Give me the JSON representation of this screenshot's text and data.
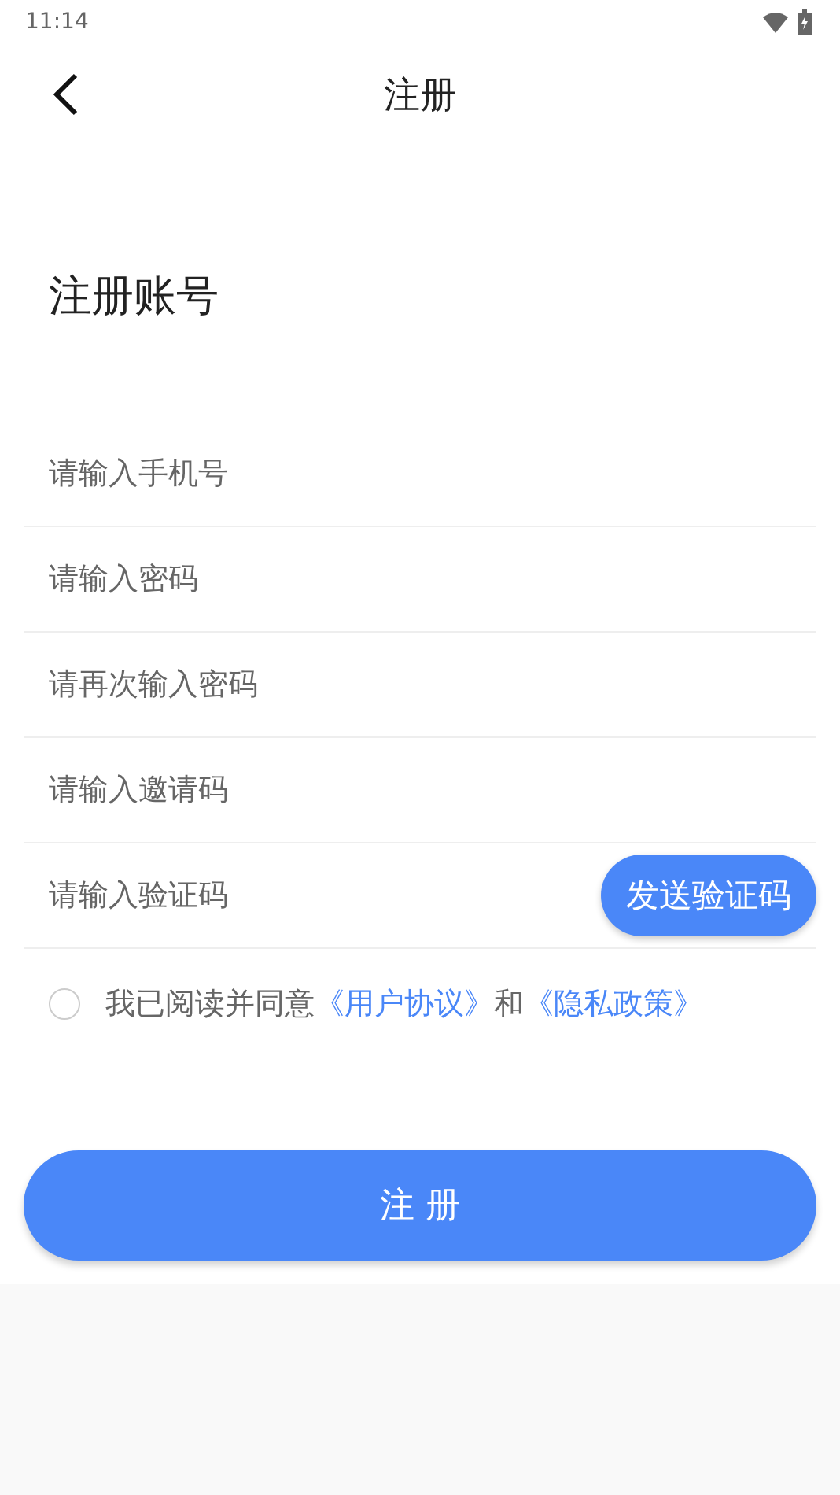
{
  "status_bar": {
    "time": "11:14"
  },
  "header": {
    "title": "注册"
  },
  "heading": "注册账号",
  "fields": [
    {
      "placeholder": "请输入手机号",
      "kind": "text"
    },
    {
      "placeholder": "请输入密码",
      "kind": "password"
    },
    {
      "placeholder": "请再次输入密码",
      "kind": "password"
    },
    {
      "placeholder": "请输入邀请码",
      "kind": "text"
    },
    {
      "placeholder": "请输入验证码",
      "kind": "code",
      "button": "发送验证码"
    }
  ],
  "agreement": {
    "checked": false,
    "parts": [
      {
        "kind": "text",
        "text": "我已阅读并同意"
      },
      {
        "kind": "link",
        "text": "《用户协议》"
      },
      {
        "kind": "text",
        "text": "和"
      },
      {
        "kind": "link",
        "text": "《隐私政策》"
      }
    ]
  },
  "submit": "注 册"
}
